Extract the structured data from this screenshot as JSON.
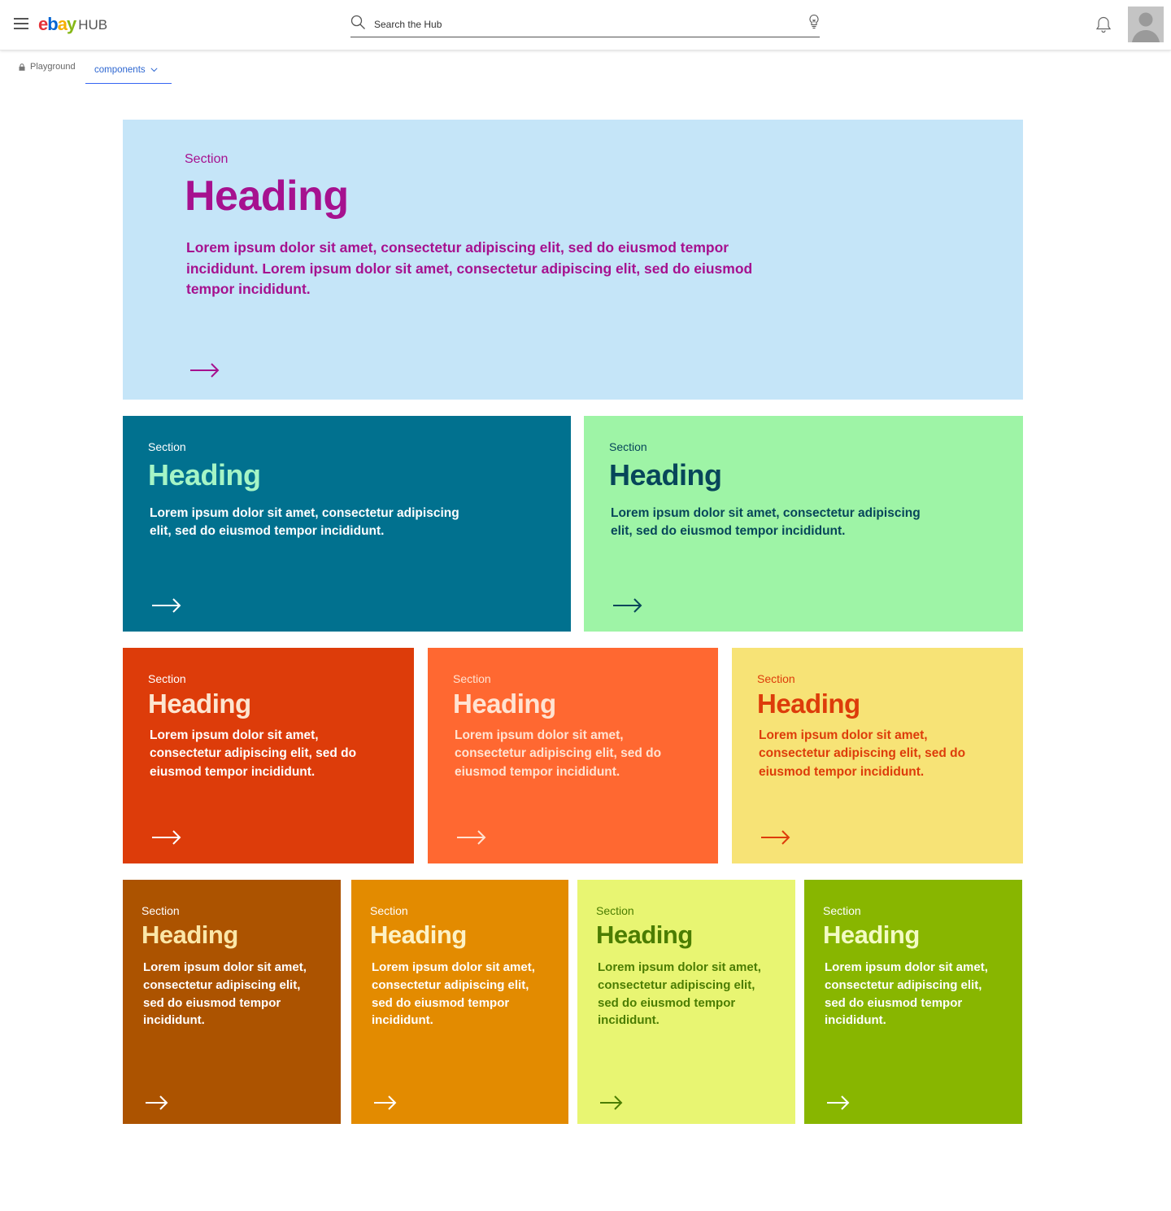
{
  "header": {
    "logo": {
      "e": "e",
      "b": "b",
      "a": "a",
      "y": "y",
      "hub": "HUB"
    },
    "search_placeholder": "Search the Hub"
  },
  "breadcrumb": {
    "item": "Playground",
    "active": "components"
  },
  "cards": {
    "hero": {
      "section": "Section",
      "heading": "Heading",
      "body": "Lorem ipsum dolor sit amet, consectetur adipiscing elit, sed do eiusmod tempor incididunt.  Lorem ipsum dolor sit amet, consectetur adipiscing elit, sed do eiusmod tempor incididunt.",
      "bg": "#c5e5f8",
      "fg": "#a6118f"
    },
    "teal": {
      "section": "Section",
      "heading": "Heading",
      "body": "Lorem ipsum dolor sit amet, consectetur adipiscing elit, sed do eiusmod tempor incididunt.",
      "bg": "#01718f",
      "fg": "#ffffff",
      "accent": "#a5f5c6"
    },
    "mint": {
      "section": "Section",
      "heading": "Heading",
      "body": "Lorem ipsum dolor sit amet, consectetur adipiscing elit, sed do eiusmod tempor incididunt.",
      "bg": "#9ef4a6",
      "fg": "#07465a"
    },
    "red": {
      "section": "Section",
      "heading": "Heading",
      "body": "Lorem ipsum dolor sit amet, consectetur adipiscing elit, sed do eiusmod tempor incididunt.",
      "bg": "#dd3c0a",
      "fg": "#ffffff",
      "accent": "#fde5d0"
    },
    "orange": {
      "section": "Section",
      "heading": "Heading",
      "body": "Lorem ipsum dolor sit amet, consectetur adipiscing elit, sed do eiusmod tempor incididunt.",
      "bg": "#ff6831",
      "fg": "#ffe3d2"
    },
    "yellow": {
      "section": "Section",
      "heading": "Heading",
      "body": "Lorem ipsum dolor sit amet, consectetur adipiscing elit, sed do eiusmod tempor incididunt.",
      "bg": "#f7e376",
      "fg": "#dd3c0a"
    },
    "brown": {
      "section": "Section",
      "heading": "Heading",
      "body": "Lorem ipsum dolor sit amet, consectetur adipiscing elit, sed do eiusmod tempor incididunt.",
      "bg": "#ac5300",
      "fg": "#ffffff",
      "accent": "#fbe7a8"
    },
    "amber": {
      "section": "Section",
      "heading": "Heading",
      "body": "Lorem ipsum dolor sit amet, consectetur adipiscing elit, sed do eiusmod tempor incididunt.",
      "bg": "#e38b00",
      "fg": "#ffffff",
      "accent": "#fdf2c6"
    },
    "lime": {
      "section": "Section",
      "heading": "Heading",
      "body": "Lorem ipsum dolor sit amet, consectetur adipiscing elit, sed do eiusmod tempor incididunt.",
      "bg": "#e8f572",
      "fg": "#4b7d02"
    },
    "green": {
      "section": "Section",
      "heading": "Heading",
      "body": "Lorem ipsum dolor sit amet, consectetur adipiscing elit, sed do eiusmod tempor incididunt.",
      "bg": "#88b600",
      "fg": "#ffffff",
      "accent": "#f3fbc4"
    }
  }
}
